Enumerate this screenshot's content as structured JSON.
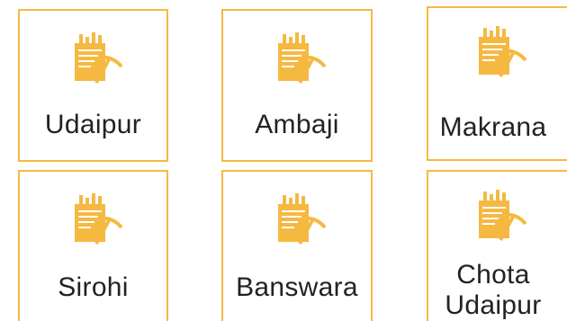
{
  "cards": [
    {
      "name": "Udaipur",
      "icon": "mining-report-icon"
    },
    {
      "name": "Ambaji",
      "icon": "mining-report-icon"
    },
    {
      "name": "Makrana",
      "icon": "mining-report-icon"
    },
    {
      "name": "Sirohi",
      "icon": "mining-report-icon"
    },
    {
      "name": "Banswara",
      "icon": "mining-report-icon"
    },
    {
      "name": "Chota Udaipur",
      "icon": "mining-report-icon"
    }
  ],
  "colors": {
    "border": "#f5b942",
    "icon_fill": "#f5b942",
    "icon_detail": "#ffffff",
    "text": "#222222"
  }
}
